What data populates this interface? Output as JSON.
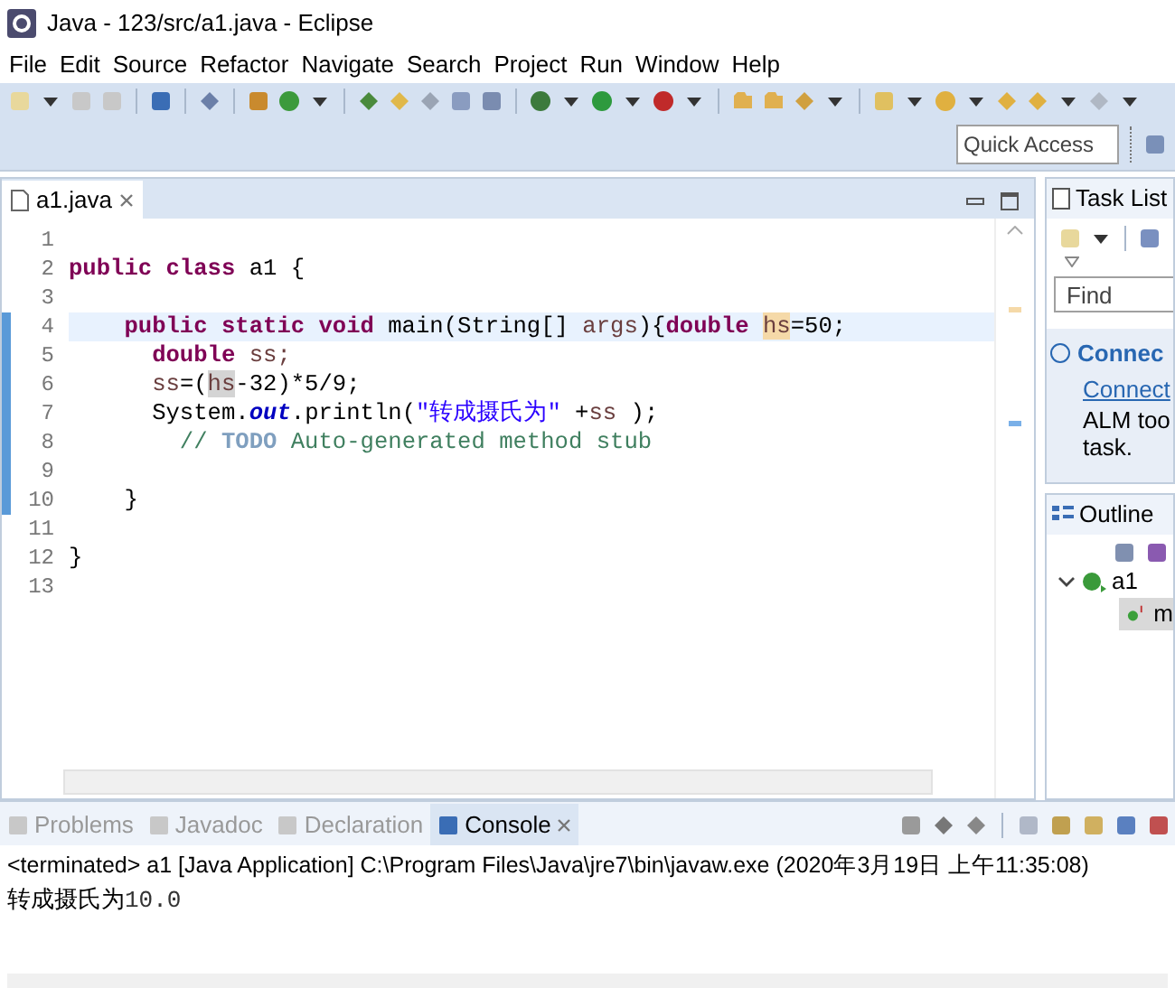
{
  "window": {
    "title": "Java - 123/src/a1.java - Eclipse"
  },
  "menu": [
    "File",
    "Edit",
    "Source",
    "Refactor",
    "Navigate",
    "Search",
    "Project",
    "Run",
    "Window",
    "Help"
  ],
  "quick_access": {
    "placeholder": "Quick Access"
  },
  "editor": {
    "tabs": [
      {
        "label": "a1.java",
        "selected": true
      }
    ],
    "lines": [
      {
        "number": "1",
        "current": false
      },
      {
        "number": "2",
        "current": false,
        "tokens": [
          {
            "kind": "kw",
            "text": "public class"
          },
          {
            "kind": "plain",
            "text": " a1 {"
          }
        ]
      },
      {
        "number": "3",
        "current": false
      },
      {
        "number": "4",
        "current": true,
        "tokens": [
          {
            "kind": "kw",
            "text": "    public static void"
          },
          {
            "kind": "plain",
            "text": " main(String[] "
          },
          {
            "kind": "param",
            "text": "args"
          },
          {
            "kind": "plain",
            "text": "){"
          },
          {
            "kind": "kw",
            "text": "double "
          },
          {
            "kind": "occurrence",
            "text": "hs"
          },
          {
            "kind": "plain",
            "text": "=50;"
          }
        ]
      },
      {
        "number": "5",
        "current": false,
        "tokens": [
          {
            "kind": "kw",
            "text": "      double"
          },
          {
            "kind": "param",
            "text": " ss;"
          }
        ]
      },
      {
        "number": "6",
        "current": false,
        "tokens": [
          {
            "kind": "param",
            "text": "      ss"
          },
          {
            "kind": "plain",
            "text": "=("
          },
          {
            "kind": "read",
            "text": "hs"
          },
          {
            "kind": "plain",
            "text": "-32)*5/9;"
          }
        ]
      },
      {
        "number": "7",
        "current": false,
        "tokens": [
          {
            "kind": "plain",
            "text": "      System."
          },
          {
            "kind": "field",
            "text": "out"
          },
          {
            "kind": "plain",
            "text": ".println("
          },
          {
            "kind": "str",
            "text": "\"转成摄氏为\""
          },
          {
            "kind": "plain",
            "text": " +"
          },
          {
            "kind": "param",
            "text": "ss"
          },
          {
            "kind": "plain",
            "text": " );"
          }
        ]
      },
      {
        "number": "8",
        "current": false,
        "tokens": [
          {
            "kind": "comment",
            "text": "        // "
          },
          {
            "kind": "todo",
            "text": "TODO"
          },
          {
            "kind": "comment",
            "text": " Auto-generated method stub"
          }
        ]
      },
      {
        "number": "9",
        "current": false
      },
      {
        "number": "10",
        "current": false,
        "tokens": [
          {
            "kind": "plain",
            "text": "    }"
          }
        ]
      },
      {
        "number": "11",
        "current": false
      },
      {
        "number": "12",
        "current": false,
        "tokens": [
          {
            "kind": "plain",
            "text": "}"
          }
        ]
      },
      {
        "number": "13",
        "current": false
      }
    ]
  },
  "task_list": {
    "title": "Task List",
    "find": {
      "placeholder": "Find"
    },
    "connect": {
      "heading": "Connec",
      "link": "Connect",
      "text_1": "ALM too",
      "text_2": "task."
    }
  },
  "outline": {
    "title": "Outline",
    "tree": [
      {
        "label": "a1",
        "expanded": true,
        "children": [
          {
            "label": "m"
          }
        ]
      }
    ]
  },
  "console": {
    "tabs": [
      {
        "label": "Problems",
        "selected": false
      },
      {
        "label": "Javadoc",
        "selected": false
      },
      {
        "label": "Declaration",
        "selected": false
      },
      {
        "label": "Console",
        "selected": true
      }
    ],
    "header": "<terminated> a1 [Java Application] C:\\Program Files\\Java\\jre7\\bin\\javaw.exe (2020年3月19日 上午11:35:08)",
    "output_label": "转成摄氏为",
    "output_value": "10.0"
  }
}
